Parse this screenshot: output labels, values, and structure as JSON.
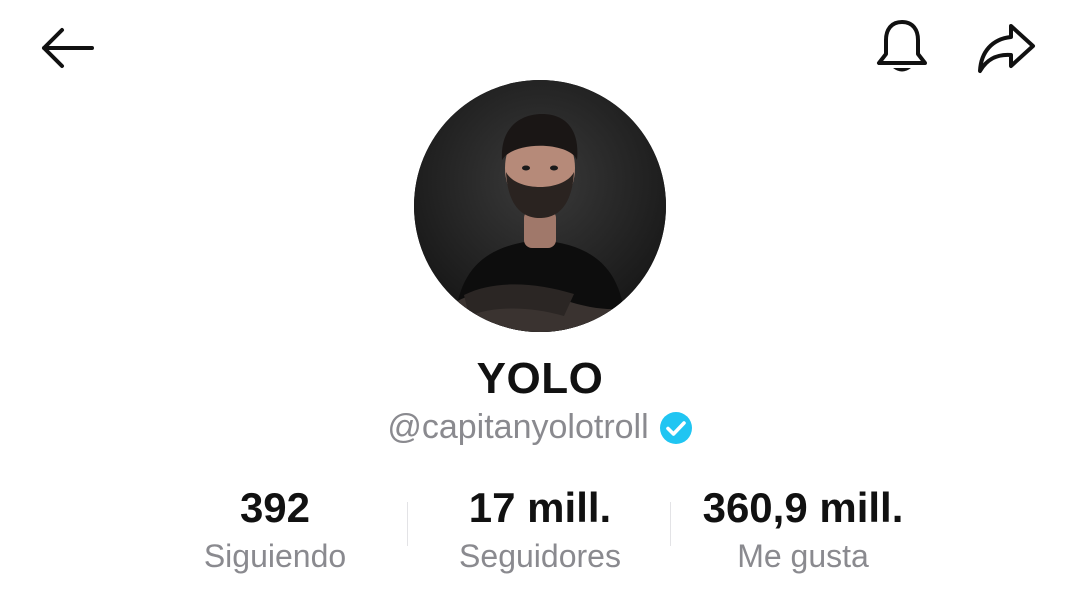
{
  "header": {
    "back_icon": "arrow-left-icon",
    "bell_icon": "bell-icon",
    "share_icon": "share-arrow-icon"
  },
  "profile": {
    "display_name": "YOLO",
    "handle": "@capitanyolotroll",
    "verified": true,
    "verified_color": "#20C5F2",
    "avatar_icon": "profile-photo"
  },
  "stats": [
    {
      "value": "392",
      "label": "Siguiendo"
    },
    {
      "value": "17 mill.",
      "label": "Seguidores"
    },
    {
      "value": "360,9 mill.",
      "label": "Me gusta"
    }
  ]
}
